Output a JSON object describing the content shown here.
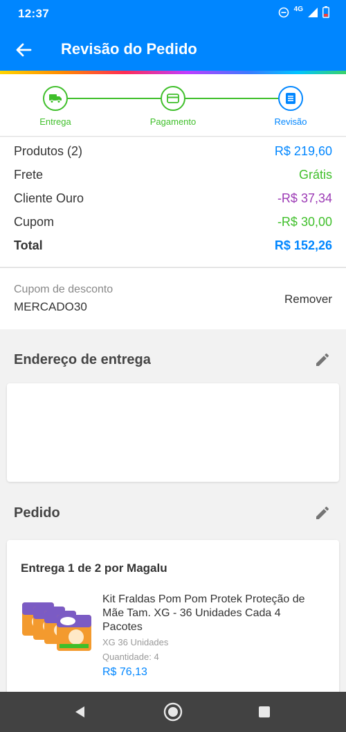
{
  "status_bar": {
    "time": "12:37",
    "network": "4G"
  },
  "app_bar": {
    "title": "Revisão do Pedido"
  },
  "stepper": {
    "steps": [
      {
        "label": "Entrega",
        "icon": "truck-icon",
        "state": "done"
      },
      {
        "label": "Pagamento",
        "icon": "card-icon",
        "state": "done"
      },
      {
        "label": "Revisão",
        "icon": "receipt-icon",
        "state": "current"
      }
    ]
  },
  "summary": {
    "products": {
      "label": "Produtos (2)",
      "value": "R$ 219,60"
    },
    "shipping": {
      "label": "Frete",
      "value": "Grátis"
    },
    "gold": {
      "label": "Cliente Ouro",
      "value": "-R$ 37,34"
    },
    "coupon": {
      "label": "Cupom",
      "value": "-R$ 30,00"
    },
    "total": {
      "label": "Total",
      "value": "R$ 152,26"
    }
  },
  "coupon": {
    "label": "Cupom de desconto",
    "code": "MERCADO30",
    "remove_label": "Remover"
  },
  "address": {
    "title": "Endereço de entrega"
  },
  "order": {
    "title": "Pedido",
    "delivery_heading": "Entrega 1 de 2 por Magalu",
    "product": {
      "name": "Kit Fraldas Pom Pom Protek Proteção de Mãe Tam. XG - 36 Unidades Cada 4 Pacotes",
      "variant": "XG 36 Unidades",
      "quantity_label": "Quantidade:",
      "quantity": "4",
      "price": "R$ 76,13"
    }
  },
  "colors": {
    "primary": "#0086ff",
    "success": "#3fbf2a",
    "discount": "#9c3ab5"
  }
}
